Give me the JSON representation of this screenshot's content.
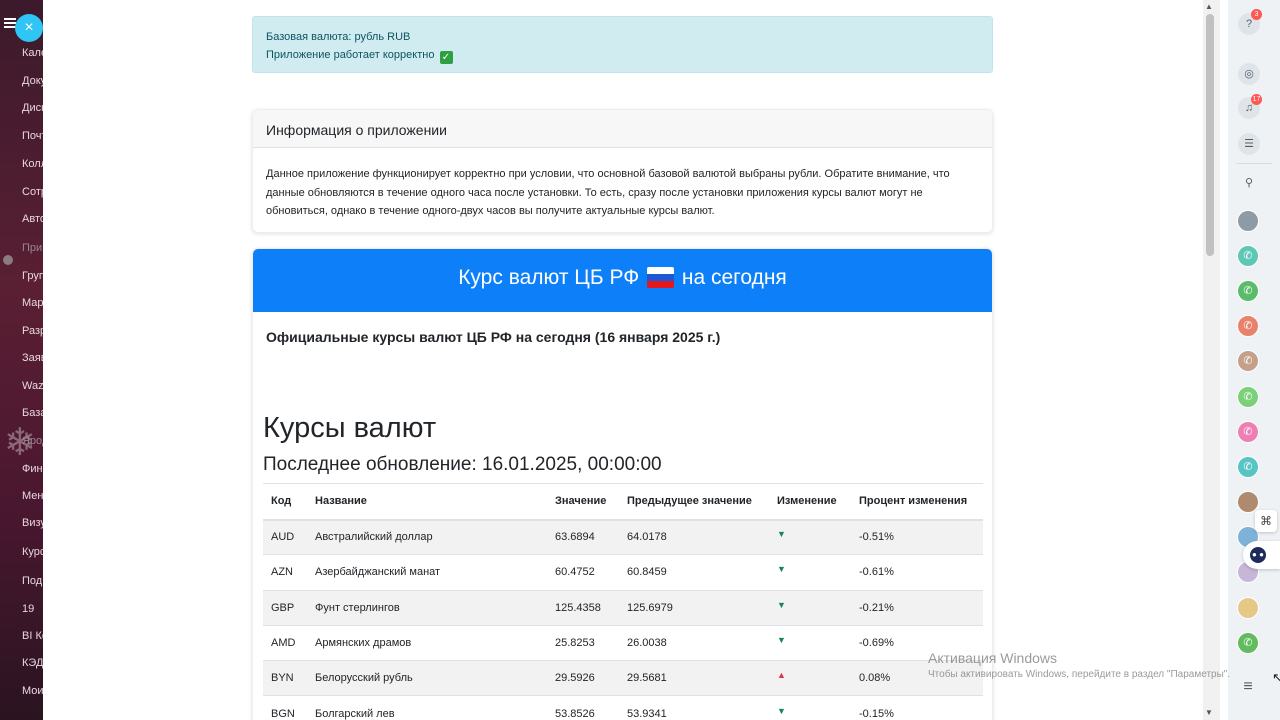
{
  "sidebar": {
    "items": [
      {
        "label": "Кале",
        "dim": false
      },
      {
        "label": "Доку",
        "dim": false
      },
      {
        "label": "Диск",
        "dim": false
      },
      {
        "label": "Почт",
        "dim": false
      },
      {
        "label": "Колл",
        "dim": false
      },
      {
        "label": "Сотр",
        "dim": false
      },
      {
        "label": "Авто",
        "dim": false
      },
      {
        "label": "При",
        "dim": true
      },
      {
        "label": "Груп",
        "dim": false
      },
      {
        "label": "Мар",
        "dim": false
      },
      {
        "label": "Разр",
        "dim": false
      },
      {
        "label": "Заяв",
        "dim": false
      },
      {
        "label": "Wazz",
        "dim": false
      },
      {
        "label": "База",
        "dim": false
      },
      {
        "label": "Ярод",
        "dim": true
      },
      {
        "label": "Фина",
        "dim": false
      },
      {
        "label": "Мен",
        "dim": false
      },
      {
        "label": "Визу",
        "dim": false
      },
      {
        "label": "Курс",
        "dim": false
      },
      {
        "label": "Подп",
        "dim": false
      },
      {
        "label": "19",
        "dim": false
      },
      {
        "label": "BI Ко",
        "dim": false
      },
      {
        "label": "КЭДО",
        "dim": false
      },
      {
        "label": "Мои",
        "dim": false
      }
    ],
    "close_icon": "×"
  },
  "alert": {
    "line1": "Базовая валюта: рубль RUB",
    "line2": "Приложение работает корректно",
    "check_icon": "✓"
  },
  "info_card": {
    "title": "Информация о приложении",
    "body": "Данное приложение функционирует корректно при условии, что основной базовой валютой выбраны рубли. Обратите внимание, что данные обновляются в течение одного часа после установки. То есть, сразу после установки приложения курсы валют могут не обновиться, однако в течение одного-двух часов вы получите актуальные курсы валют."
  },
  "rates": {
    "banner_part1": "Курс валют ЦБ РФ",
    "banner_part2": "на сегодня",
    "flag_colors": [
      "#ffffff",
      "#1c57d6",
      "#e4181c"
    ],
    "official_title": "Официальные курсы валют ЦБ РФ на сегодня (16 января 2025 г.)",
    "heading": "Курсы валют",
    "last_update": "Последнее обновление: 16.01.2025, 00:00:00",
    "columns": [
      "Код",
      "Название",
      "Значение",
      "Предыдущее значение",
      "Изменение",
      "Процент изменения"
    ],
    "rows": [
      {
        "code": "AUD",
        "name": "Австралийский доллар",
        "value": "63.6894",
        "prev": "64.0178",
        "dir": "down",
        "pct": "-0.51%"
      },
      {
        "code": "AZN",
        "name": "Азербайджанский манат",
        "value": "60.4752",
        "prev": "60.8459",
        "dir": "down",
        "pct": "-0.61%"
      },
      {
        "code": "GBP",
        "name": "Фунт стерлингов",
        "value": "125.4358",
        "prev": "125.6979",
        "dir": "down",
        "pct": "-0.21%"
      },
      {
        "code": "AMD",
        "name": "Армянских драмов",
        "value": "25.8253",
        "prev": "26.0038",
        "dir": "down",
        "pct": "-0.69%"
      },
      {
        "code": "BYN",
        "name": "Белорусский рубль",
        "value": "29.5926",
        "prev": "29.5681",
        "dir": "up",
        "pct": "0.08%"
      },
      {
        "code": "BGN",
        "name": "Болгарский лев",
        "value": "53.8526",
        "prev": "53.9341",
        "dir": "down",
        "pct": "-0.15%"
      }
    ]
  },
  "right_panel": {
    "help_badge": "3",
    "bell_badge": "17",
    "avatar_colors": [
      "#8d9ba6",
      "#5ec7b6",
      "#5cbb6a",
      "#e8826c",
      "#c4a08b",
      "#7bd07a",
      "#ee7fb4",
      "#58c4c4",
      "#b08a6e",
      "#7fb2d8",
      "#c7b6d8",
      "#e6c88a",
      "#62bb5f"
    ]
  },
  "watermark": {
    "title": "Активация Windows",
    "subtitle": "Чтобы активировать Windows, перейдите в раздел \"Параметры\"."
  }
}
